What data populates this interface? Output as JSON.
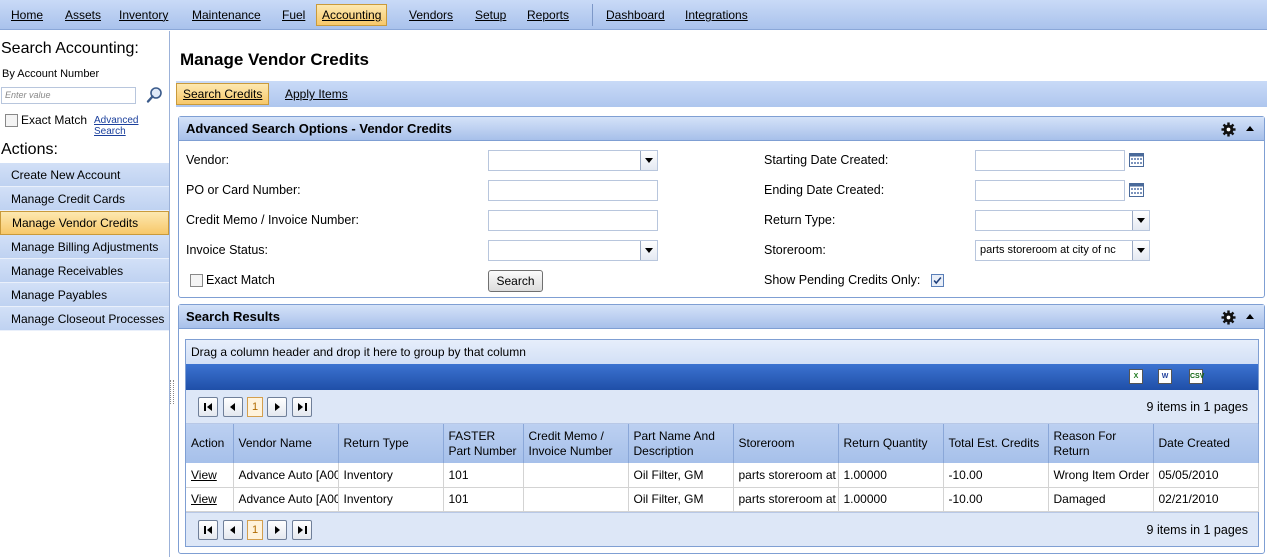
{
  "topnav": {
    "items": [
      "Home",
      "Assets",
      "Inventory",
      "Maintenance",
      "Fuel",
      "Accounting",
      "Vendors",
      "Setup",
      "Reports",
      "Dashboard",
      "Integrations"
    ],
    "active": "Accounting"
  },
  "left": {
    "title": "Search Accounting:",
    "sub": "By Account Number",
    "input_placeholder": "Enter value",
    "exact_match": "Exact Match",
    "advanced_search": "Advanced Search",
    "actions_title": "Actions:",
    "menu": [
      "Create New Account",
      "Manage Credit Cards",
      "Manage Vendor Credits",
      "Manage Billing Adjustments",
      "Manage Receivables",
      "Manage Payables",
      "Manage Closeout Processes"
    ],
    "active": "Manage Vendor Credits"
  },
  "page_title": "Manage Vendor Credits",
  "tabs": [
    "Search Credits",
    "Apply Items"
  ],
  "search_panel": {
    "title": "Advanced Search Options - Vendor Credits",
    "vendor_label": "Vendor:",
    "po_label": "PO or Card Number:",
    "credit_memo_label": "Credit Memo / Invoice Number:",
    "invoice_status_label": "Invoice Status:",
    "exact_match": "Exact Match",
    "search_button": "Search",
    "start_date_label": "Starting Date Created:",
    "end_date_label": "Ending Date Created:",
    "return_type_label": "Return Type:",
    "storeroom_label": "Storeroom:",
    "storeroom_value": "parts storeroom at city of nc",
    "pending_label": "Show Pending Credits Only:",
    "pending_checked": true
  },
  "results_panel": {
    "title": "Search Results",
    "group_hint": "Drag a column header and drop it here to group by that column",
    "page": "1",
    "items_info": "9 items in 1 pages",
    "columns": [
      "Action",
      "Vendor Name",
      "Return Type",
      "FASTER Part Number",
      "Credit Memo / Invoice Number",
      "Part Name And Description",
      "Storeroom",
      "Return Quantity",
      "Total Est. Credits",
      "Reason For Return",
      "Date Created"
    ],
    "rows": [
      [
        "View",
        "Advance Auto [A00",
        "Inventory",
        "101",
        "",
        "Oil Filter, GM",
        "parts storeroom at",
        "1.00000",
        "-10.00",
        "Wrong Item Order",
        "05/05/2010"
      ],
      [
        "View",
        "Advance Auto [A00",
        "Inventory",
        "101",
        "",
        "Oil Filter, GM",
        "parts storeroom at",
        "1.00000",
        "-10.00",
        "Damaged",
        "02/21/2010"
      ]
    ]
  }
}
